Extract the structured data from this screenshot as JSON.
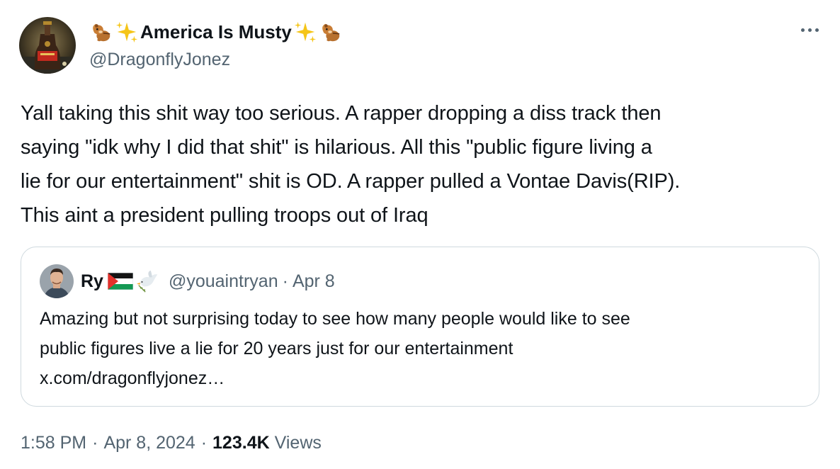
{
  "author": {
    "display_name": "America Is Musty",
    "handle": "@DragonflyJonez",
    "avatar_icon": "bottle-avatar",
    "name_emoji": [
      "chipmunk-icon",
      "sparkles-icon"
    ]
  },
  "menu": {
    "icon": "more-horizontal-icon"
  },
  "tweet": {
    "lines": [
      "Yall taking this shit way too serious. A rapper dropping a diss track then",
      "saying \"idk why I did that shit\" is hilarious. All this \"public figure living a",
      "lie for our entertainment\" shit is OD. A rapper pulled a Vontae Davis(RIP).",
      "This aint a president pulling troops out of Iraq"
    ]
  },
  "quote": {
    "display_name": "Ry",
    "handle": "@youaintryan",
    "separator": "·",
    "date": "Apr 8",
    "name_emoji": [
      "palestine-flag-icon",
      "dove-icon"
    ],
    "lines": [
      "Amazing but not surprising today to see how many people would like to see",
      "public figures live a lie for 20 years just for our entertainment",
      "x.com/dragonflyjonez…"
    ]
  },
  "meta": {
    "time": "1:58 PM",
    "separator": "·",
    "date": "Apr 8, 2024",
    "views_count": "123.4K",
    "views_label": "Views"
  },
  "colors": {
    "text": "#0f1419",
    "secondary": "#536471",
    "border": "#cfd9de"
  }
}
